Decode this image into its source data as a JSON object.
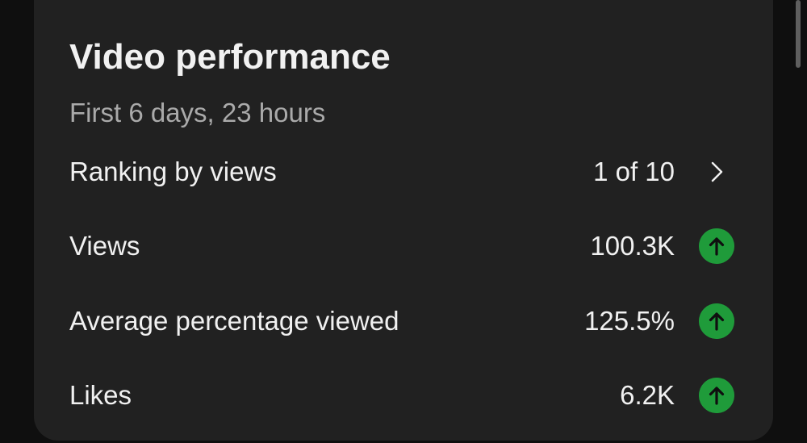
{
  "card": {
    "title": "Video performance",
    "subtitle": "First 6 days, 23 hours"
  },
  "metrics": [
    {
      "label": "Ranking by views",
      "value": "1 of 10",
      "indicator": "chevron-right-icon"
    },
    {
      "label": "Views",
      "value": "100.3K",
      "indicator": "arrow-up-circle-icon"
    },
    {
      "label": "Average percentage viewed",
      "value": "125.5%",
      "indicator": "arrow-up-circle-icon"
    },
    {
      "label": "Likes",
      "value": "6.2K",
      "indicator": "arrow-up-circle-icon"
    }
  ],
  "colors": {
    "background": "#0f0f0f",
    "card": "#212121",
    "text": "#f1f1f1",
    "secondary_text": "#aaaaaa",
    "positive": "#1f9b3a"
  }
}
